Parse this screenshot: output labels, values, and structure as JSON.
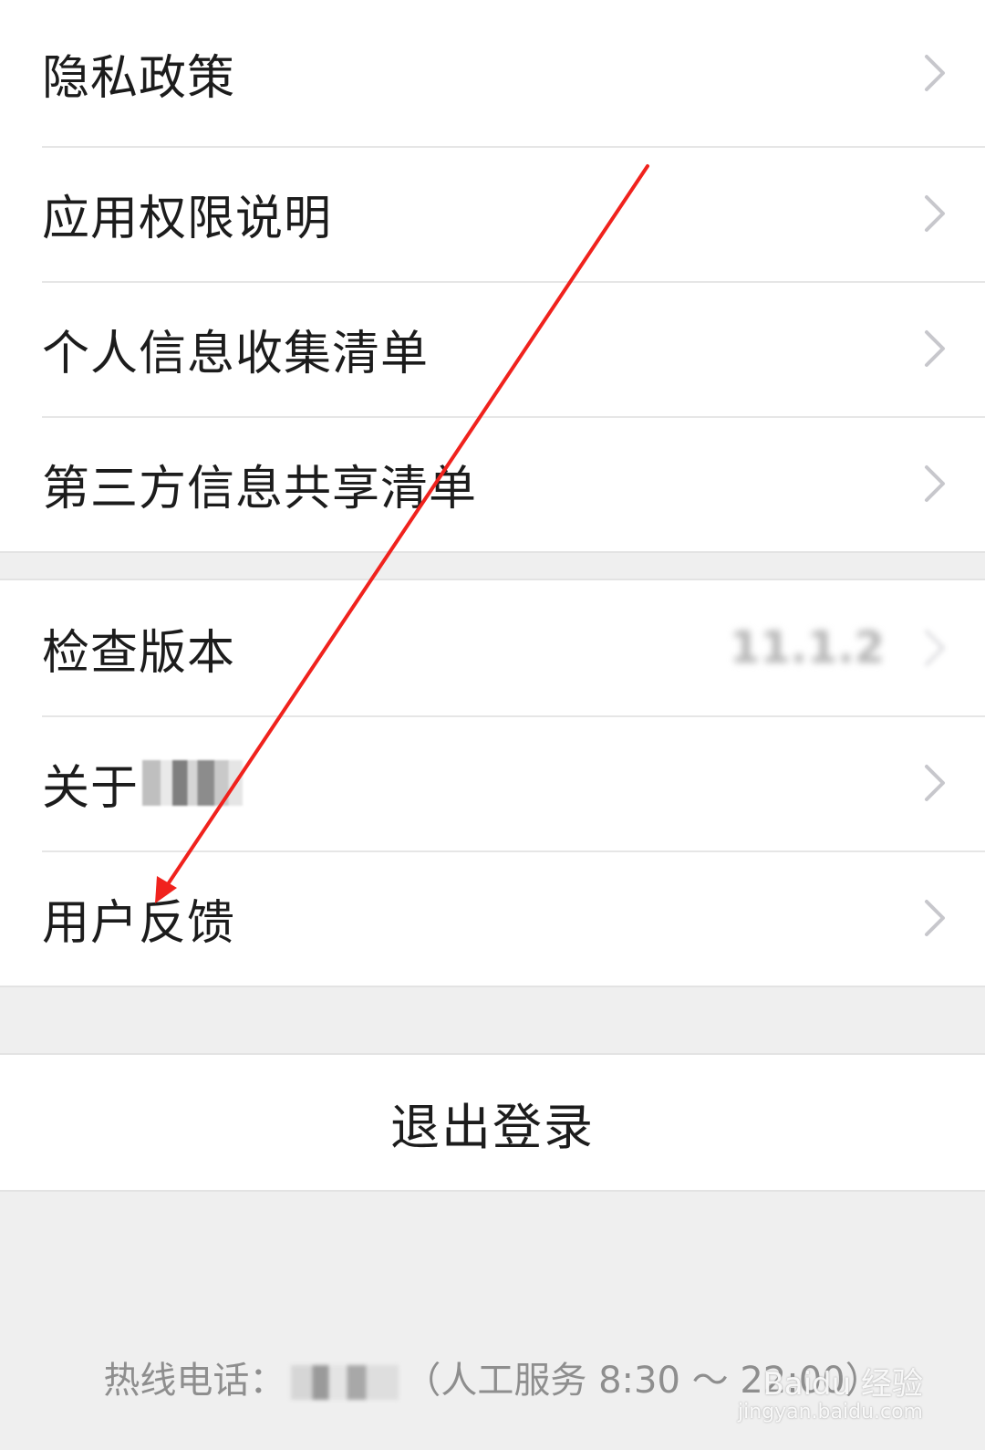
{
  "settings_group_1": {
    "items": [
      {
        "label": "隐私政策"
      },
      {
        "label": "应用权限说明"
      },
      {
        "label": "个人信息收集清单"
      },
      {
        "label": "第三方信息共享清单"
      }
    ]
  },
  "settings_group_2": {
    "check_version": {
      "label": "检查版本",
      "value": "11.1.2"
    },
    "about": {
      "label": "关于"
    },
    "feedback": {
      "label": "用户反馈"
    }
  },
  "logout": {
    "label": "退出登录"
  },
  "footer": {
    "hotline_prefix": "热线电话：",
    "hotline_suffix": "（人工服务 8:30 ～ 22:00）"
  },
  "watermark": {
    "brand": "Baidu 经验",
    "url": "jingyan.baidu.com"
  },
  "colors": {
    "background": "#efefef",
    "row_background": "#ffffff",
    "text_primary": "#1c1c1c",
    "text_secondary": "#8e8e8e",
    "chevron": "#c7c7cc",
    "annotation_arrow": "#f0221d"
  },
  "icons": {
    "row_chevron": "chevron-right-icon",
    "annotation": "red-arrow-annotation"
  }
}
